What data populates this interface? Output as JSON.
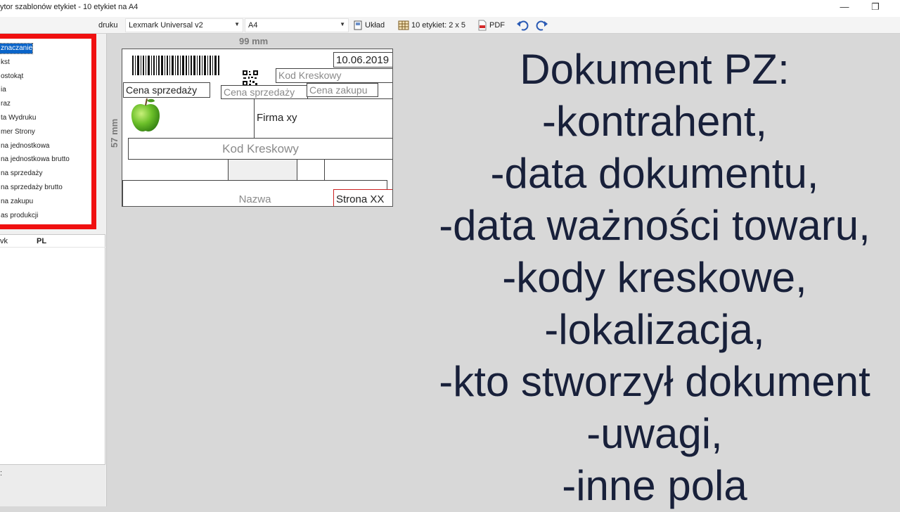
{
  "window": {
    "title": "ytor szablonów etykiet - 10 etykiet na A4",
    "restore_icon": "restore-icon",
    "minimize_icon": "minimize-icon"
  },
  "toolbar": {
    "partial_left": "druku",
    "printer": "Lexmark Universal v2",
    "paper": "A4",
    "layout_label": "Układ",
    "labels_label": "10 etykiet: 2 x 5",
    "pdf_label": "PDF",
    "undo_icon": "undo-icon",
    "redo_icon": "redo-icon"
  },
  "element_list": {
    "items": [
      "znaczanie",
      "kst",
      "ostokąt",
      "ia",
      "raz",
      "ta Wydruku",
      "mer Strony",
      "na jednostkowa",
      "na jednostkowa brutto",
      "na sprzedaży",
      "na sprzedaży brutto",
      "na zakupu",
      "as produkcji"
    ],
    "selected_index": 0,
    "highlight_color": "#f01010"
  },
  "properties": {
    "col1": "vk",
    "col2": "PL",
    "partial_bottom": ":"
  },
  "rulers": {
    "width": "99 mm",
    "height": "57 mm"
  },
  "label": {
    "date": "10.06.2019",
    "barcode_top": "Kod Kreskowy",
    "price_sale_bold": "Cena sprzedaży",
    "price_sale": "Cena sprzedaży",
    "price_purchase": "Cena zakupu",
    "company": "Firma xy",
    "barcode_main": "Kod Kreskowy",
    "name": "Nazwa",
    "page": "Strona XX"
  },
  "overlay": {
    "lines": [
      "Dokument PZ:",
      "-kontrahent,",
      "-data dokumentu,",
      "-data ważności towaru,",
      "-kody kreskowe,",
      "-lokalizacja,",
      "-kto  stworzył dokument",
      "-uwagi,",
      "-inne pola"
    ],
    "color": "#18203a"
  }
}
